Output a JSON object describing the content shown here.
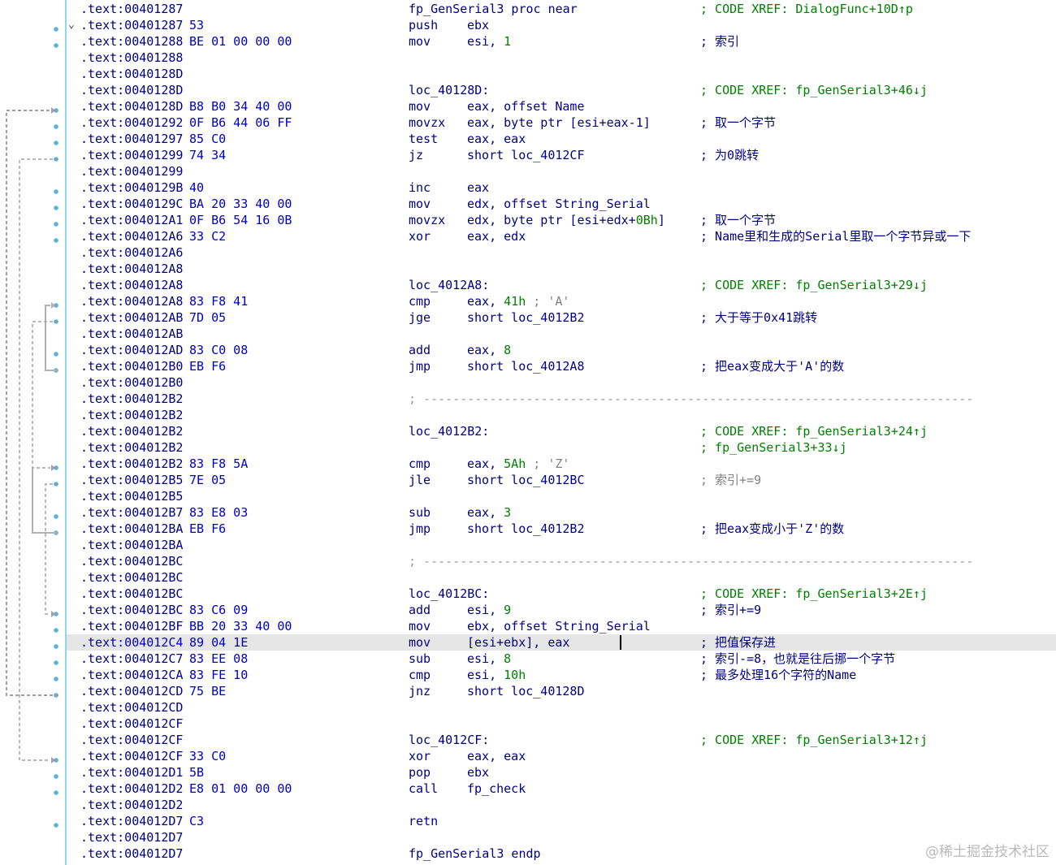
{
  "listing": [
    {
      "addr": ".text:00401287",
      "bytes": "",
      "label": "fp_GenSerial3 proc near",
      "comment": "; CODE XREF: DialogFunc+10D↑p",
      "comment_style": "xref"
    },
    {
      "addr": ".text:00401287",
      "bytes": "53",
      "mnem": "push",
      "ops": "ebx",
      "fold": "⌄"
    },
    {
      "addr": ".text:00401288",
      "bytes": "BE 01 00 00 00",
      "mnem": "mov",
      "ops": "esi, ",
      "num": "1",
      "comment": "; 索引"
    },
    {
      "addr": ".text:00401288"
    },
    {
      "addr": ".text:0040128D"
    },
    {
      "addr": ".text:0040128D",
      "label": "loc_40128D:",
      "comment": "; CODE XREF: fp_GenSerial3+46↓j",
      "comment_style": "xref"
    },
    {
      "addr": ".text:0040128D",
      "bytes": "B8 B0 34 40 00",
      "mnem": "mov",
      "ops": "eax, offset Name"
    },
    {
      "addr": ".text:00401292",
      "bytes": "0F B6 44 06 FF",
      "mnem": "movzx",
      "ops": "eax, byte ptr [esi+eax-1]",
      "comment": "; 取一个字节"
    },
    {
      "addr": ".text:00401297",
      "bytes": "85 C0",
      "mnem": "test",
      "ops": "eax, eax"
    },
    {
      "addr": ".text:00401299",
      "bytes": "74 34",
      "mnem": "jz",
      "ops": "short loc_4012CF",
      "comment": "; 为0跳转"
    },
    {
      "addr": ".text:00401299"
    },
    {
      "addr": ".text:0040129B",
      "bytes": "40",
      "mnem": "inc",
      "ops": "eax"
    },
    {
      "addr": ".text:0040129C",
      "bytes": "BA 20 33 40 00",
      "mnem": "mov",
      "ops": "edx, offset String_Serial"
    },
    {
      "addr": ".text:004012A1",
      "bytes": "0F B6 54 16 0B",
      "mnem": "movzx",
      "ops": "edx, byte ptr [esi+edx+",
      "num": "0Bh",
      "ops2": "]",
      "comment": "; 取一个字节"
    },
    {
      "addr": ".text:004012A6",
      "bytes": "33 C2",
      "mnem": "xor",
      "ops": "eax, edx",
      "comment": "; Name里和生成的Serial里取一个字节异或一下"
    },
    {
      "addr": ".text:004012A6"
    },
    {
      "addr": ".text:004012A8"
    },
    {
      "addr": ".text:004012A8",
      "label": "loc_4012A8:",
      "comment": "; CODE XREF: fp_GenSerial3+29↓j",
      "comment_style": "xref"
    },
    {
      "addr": ".text:004012A8",
      "bytes": "83 F8 41",
      "mnem": "cmp",
      "ops": "eax, ",
      "num": "41h",
      "chr": " ; 'A'"
    },
    {
      "addr": ".text:004012AB",
      "bytes": "7D 05",
      "mnem": "jge",
      "ops": "short loc_4012B2",
      "comment": "; 大于等于0x41跳转"
    },
    {
      "addr": ".text:004012AB"
    },
    {
      "addr": ".text:004012AD",
      "bytes": "83 C0 08",
      "mnem": "add",
      "ops": "eax, ",
      "num": "8"
    },
    {
      "addr": ".text:004012B0",
      "bytes": "EB F6",
      "mnem": "jmp",
      "ops": "short loc_4012A8",
      "comment": "; 把eax变成大于'A'的数"
    },
    {
      "addr": ".text:004012B0"
    },
    {
      "addr": ".text:004012B2",
      "sep": "; ---------------------------------------------------------------------------"
    },
    {
      "addr": ".text:004012B2"
    },
    {
      "addr": ".text:004012B2",
      "label": "loc_4012B2:",
      "comment": "; CODE XREF: fp_GenSerial3+24↑j",
      "comment_style": "xref"
    },
    {
      "addr": ".text:004012B2",
      "comment": "; fp_GenSerial3+33↓j",
      "comment_style": "xref"
    },
    {
      "addr": ".text:004012B2",
      "bytes": "83 F8 5A",
      "mnem": "cmp",
      "ops": "eax, ",
      "num": "5Ah",
      "chr": " ; 'Z'"
    },
    {
      "addr": ".text:004012B5",
      "bytes": "7E 05",
      "mnem": "jle",
      "ops": "short loc_4012BC",
      "comment": "; 索引+=9",
      "comment_style": "grey"
    },
    {
      "addr": ".text:004012B5"
    },
    {
      "addr": ".text:004012B7",
      "bytes": "83 E8 03",
      "mnem": "sub",
      "ops": "eax, ",
      "num": "3"
    },
    {
      "addr": ".text:004012BA",
      "bytes": "EB F6",
      "mnem": "jmp",
      "ops": "short loc_4012B2",
      "comment": "; 把eax变成小于'Z'的数"
    },
    {
      "addr": ".text:004012BA"
    },
    {
      "addr": ".text:004012BC",
      "sep": "; ---------------------------------------------------------------------------"
    },
    {
      "addr": ".text:004012BC"
    },
    {
      "addr": ".text:004012BC",
      "label": "loc_4012BC:",
      "comment": "; CODE XREF: fp_GenSerial3+2E↑j",
      "comment_style": "xref"
    },
    {
      "addr": ".text:004012BC",
      "bytes": "83 C6 09",
      "mnem": "add",
      "ops": "esi, ",
      "num": "9",
      "comment": "; 索引+=9"
    },
    {
      "addr": ".text:004012BF",
      "bytes": "BB 20 33 40 00",
      "mnem": "mov",
      "ops": "ebx, offset String_Serial"
    },
    {
      "addr": ".text:004012C4",
      "bytes": "89 04 1E",
      "mnem": "mov",
      "ops": "[esi+ebx], eax",
      "comment": "; 把值保存进",
      "highlight": true
    },
    {
      "addr": ".text:004012C7",
      "bytes": "83 EE 08",
      "mnem": "sub",
      "ops": "esi, ",
      "num": "8",
      "comment": "; 索引-=8，也就是往后挪一个字节"
    },
    {
      "addr": ".text:004012CA",
      "bytes": "83 FE 10",
      "mnem": "cmp",
      "ops": "esi, ",
      "num": "10h",
      "comment": "; 最多处理16个字符的Name"
    },
    {
      "addr": ".text:004012CD",
      "bytes": "75 BE",
      "mnem": "jnz",
      "ops": "short loc_40128D"
    },
    {
      "addr": ".text:004012CD"
    },
    {
      "addr": ".text:004012CF"
    },
    {
      "addr": ".text:004012CF",
      "label": "loc_4012CF:",
      "comment": "; CODE XREF: fp_GenSerial3+12↑j",
      "comment_style": "xref"
    },
    {
      "addr": ".text:004012CF",
      "bytes": "33 C0",
      "mnem": "xor",
      "ops": "eax, eax"
    },
    {
      "addr": ".text:004012D1",
      "bytes": "5B",
      "mnem": "pop",
      "ops": "ebx"
    },
    {
      "addr": ".text:004012D2",
      "bytes": "E8 01 00 00 00",
      "mnem": "call",
      "ops": "fp_check"
    },
    {
      "addr": ".text:004012D2"
    },
    {
      "addr": ".text:004012D7",
      "bytes": "C3",
      "mnem": "retn"
    },
    {
      "addr": ".text:004012D7"
    },
    {
      "addr": ".text:004012D7",
      "label": "fp_GenSerial3 endp"
    }
  ],
  "watermark": "@稀土掘金技术社区",
  "colors": {
    "address": "#000080",
    "bytes": "#0000c0",
    "xref_comment": "#008000",
    "numeric": "#008000",
    "separator": "#999999",
    "highlight_row": "#e6e6e6",
    "gutter_border": "#9ccfe8",
    "breakpoint_dot": "#5aaee0",
    "arrow_dashed": "#a0a0a0",
    "arrow_solid": "#b0b0b0"
  }
}
